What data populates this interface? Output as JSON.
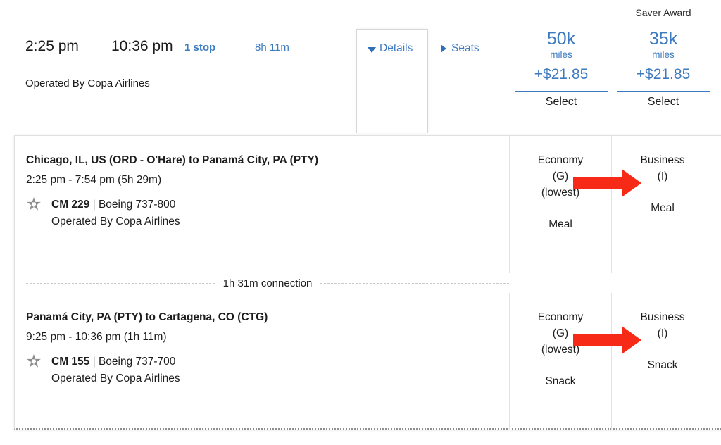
{
  "summary": {
    "depart_time": "2:25 pm",
    "arrive_time": "10:36 pm",
    "stops": "1 stop",
    "duration": "8h 11m",
    "operated_by": "Operated By Copa Airlines",
    "details_label": "Details",
    "seats_label": "Seats",
    "details_icon": "chevron-down-icon",
    "seats_icon": "chevron-right-icon"
  },
  "fares": {
    "header_label": "Saver Award",
    "columns": [
      {
        "miles": "50k",
        "unit": "miles",
        "tax": "+$21.85",
        "select_label": "Select",
        "header": ""
      },
      {
        "miles": "35k",
        "unit": "miles",
        "tax": "+$21.85",
        "select_label": "Select",
        "header": "Saver Award"
      }
    ]
  },
  "details": {
    "segments": [
      {
        "route": "Chicago, IL, US (ORD - O'Hare) to Panamá City, PA (PTY)",
        "times": "2:25 pm - 7:54 pm (5h 29m)",
        "alliance_icon": "star-alliance-icon",
        "flight_number": "CM 229",
        "separator": "|",
        "aircraft": "Boeing 737-800",
        "operated_by": "Operated By Copa Airlines",
        "economy": {
          "cabin": "Economy",
          "booking_class": "(G)",
          "note": "(lowest)",
          "service": "Meal"
        },
        "business": {
          "cabin": "Business",
          "booking_class": "(I)",
          "note": "",
          "service": "Meal"
        }
      },
      {
        "route": "Panamá City, PA (PTY) to Cartagena, CO (CTG)",
        "times": "9:25 pm - 10:36 pm (1h 11m)",
        "alliance_icon": "star-alliance-icon",
        "flight_number": "CM 155",
        "separator": "|",
        "aircraft": "Boeing 737-700",
        "operated_by": "Operated By Copa Airlines",
        "economy": {
          "cabin": "Economy",
          "booking_class": "(G)",
          "note": "(lowest)",
          "service": "Snack"
        },
        "business": {
          "cabin": "Business",
          "booking_class": "(I)",
          "note": "",
          "service": "Snack"
        }
      }
    ],
    "connection_label": "1h 31m connection"
  },
  "colors": {
    "link_blue": "#3d7ac0",
    "annotation_red": "#f72a18",
    "text": "#1c1c1c"
  }
}
